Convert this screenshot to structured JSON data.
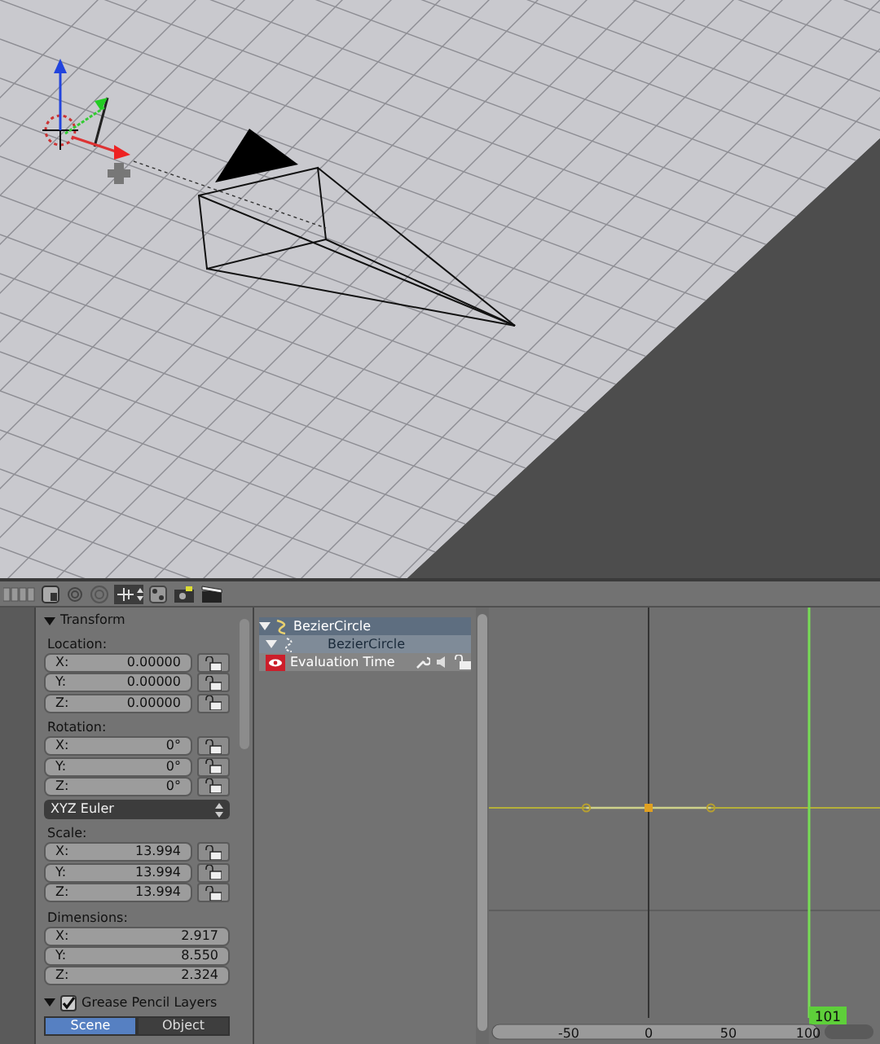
{
  "transform": {
    "title": "Transform",
    "expanded": true,
    "groups": [
      {
        "label": "Location:",
        "fields": [
          {
            "axis": "X:",
            "value": "0.00000",
            "locked": false
          },
          {
            "axis": "Y:",
            "value": "0.00000",
            "locked": false
          },
          {
            "axis": "Z:",
            "value": "0.00000",
            "locked": false
          }
        ]
      },
      {
        "label": "Rotation:",
        "fields": [
          {
            "axis": "X:",
            "value": "0°",
            "locked": false
          },
          {
            "axis": "Y:",
            "value": "0°",
            "locked": false
          },
          {
            "axis": "Z:",
            "value": "0°",
            "locked": false
          }
        ],
        "mode": "XYZ Euler"
      },
      {
        "label": "Scale:",
        "fields": [
          {
            "axis": "X:",
            "value": "13.994",
            "locked": false
          },
          {
            "axis": "Y:",
            "value": "13.994",
            "locked": false
          },
          {
            "axis": "Z:",
            "value": "13.994",
            "locked": false
          }
        ]
      },
      {
        "label": "Dimensions:",
        "fields": [
          {
            "axis": "X:",
            "value": "2.917"
          },
          {
            "axis": "Y:",
            "value": "8.550"
          },
          {
            "axis": "Z:",
            "value": "2.324"
          }
        ]
      }
    ]
  },
  "grease_pencil": {
    "title": "Grease Pencil Layers",
    "checked": true,
    "expanded": true,
    "tabs": [
      {
        "label": "Scene",
        "selected": true
      },
      {
        "label": "Object",
        "selected": false
      }
    ]
  },
  "channels": [
    {
      "name": "BezierCircle",
      "kind": "object",
      "expanded": true
    },
    {
      "name": "BezierCircle",
      "kind": "data",
      "expanded": true
    },
    {
      "name": "Evaluation Time",
      "kind": "fcurve"
    }
  ],
  "graph": {
    "x_labels": [
      "-50",
      "0",
      "50",
      "100"
    ],
    "current_frame": "101"
  }
}
